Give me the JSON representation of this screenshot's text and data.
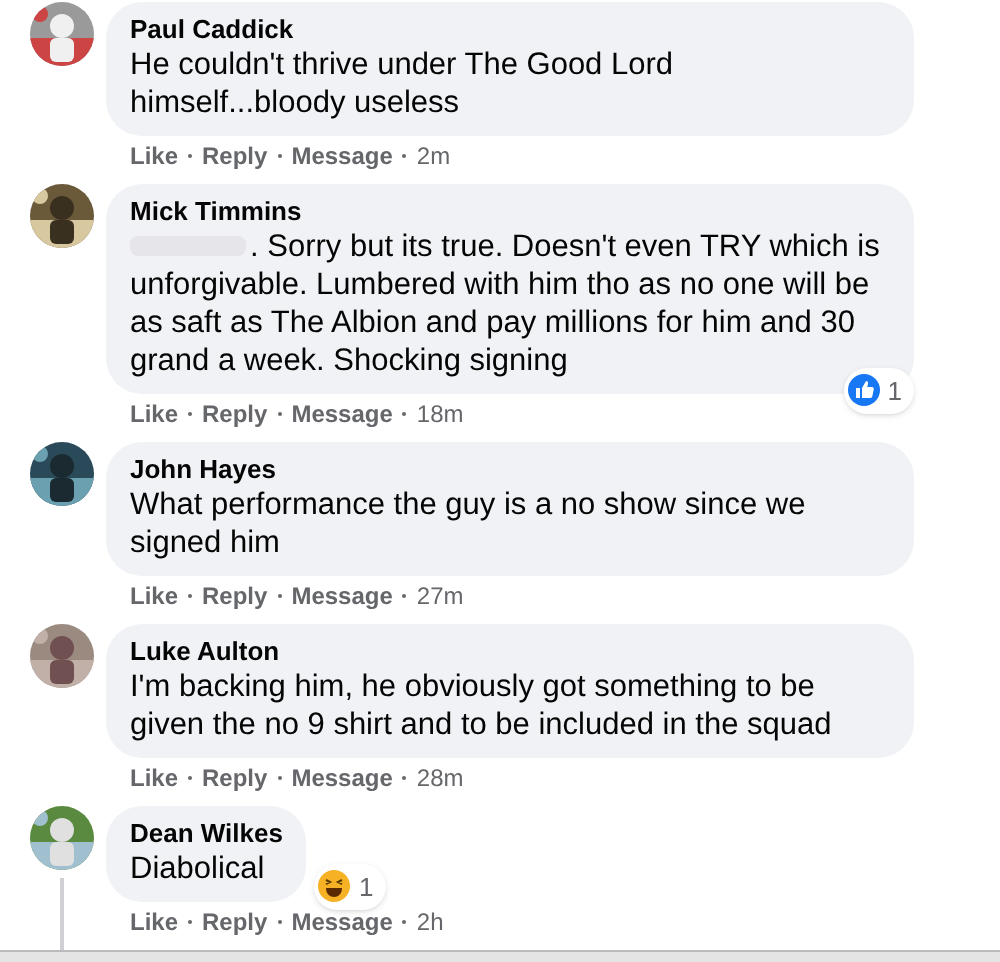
{
  "comments": [
    {
      "author": "Paul Caddick",
      "text": "He couldn't thrive under The Good Lord himself...bloody useless",
      "redacted": false,
      "actions": [
        "Like",
        "Reply",
        "Message"
      ],
      "time": "2m",
      "thread": false
    },
    {
      "author": "Mick Timmins",
      "text": ". Sorry but its true. Doesn't even TRY which is unforgivable. Lumbered with him tho as no one will be as saft as The Albion and pay millions for him and 30 grand a week. Shocking signing",
      "redacted": true,
      "actions": [
        "Like",
        "Reply",
        "Message"
      ],
      "time": "18m",
      "reaction": {
        "kind": "like",
        "count": "1"
      },
      "thread": false
    },
    {
      "author": "John Hayes",
      "text": "What performance the guy is a no show since we signed him",
      "redacted": false,
      "actions": [
        "Like",
        "Reply",
        "Message"
      ],
      "time": "27m",
      "thread": false
    },
    {
      "author": "Luke Aulton",
      "text": "I'm backing him, he obviously got something to be given the no 9 shirt and to be included in the squad",
      "redacted": false,
      "actions": [
        "Like",
        "Reply",
        "Message"
      ],
      "time": "28m",
      "thread": false
    },
    {
      "author": "Dean Wilkes",
      "text": "Diabolical",
      "redacted": false,
      "actions": [
        "Like",
        "Reply",
        "Message"
      ],
      "time": "2h",
      "reaction": {
        "kind": "haha",
        "count": "1"
      },
      "thread": true
    }
  ]
}
